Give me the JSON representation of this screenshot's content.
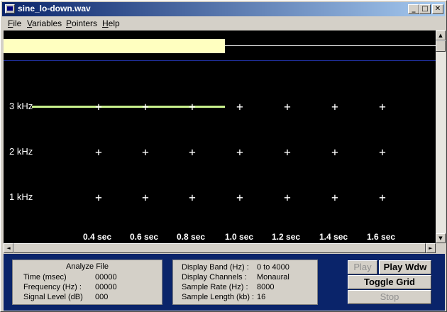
{
  "window": {
    "title": "sine_lo-down.wav",
    "min_glyph": "_",
    "max_glyph": "□",
    "close_glyph": "✕"
  },
  "menu": [
    {
      "label": "File",
      "key": "F",
      "rest": "ile"
    },
    {
      "label": "Variables",
      "key": "V",
      "rest": "ariables"
    },
    {
      "label": "Pointers",
      "key": "P",
      "rest": "ointers"
    },
    {
      "label": "Help",
      "key": "H",
      "rest": "elp"
    }
  ],
  "display": {
    "freq_labels": [
      "3  kHz",
      "2  kHz",
      "1  kHz"
    ],
    "time_labels": [
      "0.4 sec",
      "0.6 sec",
      "0.8 sec",
      "1.0 sec",
      "1.2 sec",
      "1.4 sec",
      "1.6 sec"
    ],
    "grid_marker": "+",
    "colors": {
      "background": "#000000",
      "signal": "#c8f08c",
      "highlight": "#ffffc0",
      "divider": "#2030a0"
    }
  },
  "analyze": {
    "title": "Analyze File",
    "rows": [
      {
        "label": "Time (msec)",
        "value": "00000"
      },
      {
        "label": "Frequency (Hz) :",
        "value": "00000"
      },
      {
        "label": "Signal Level (dB)",
        "value": "000"
      }
    ]
  },
  "file_info": {
    "rows": [
      {
        "label": "Display Band (Hz) :",
        "value": "0 to 4000"
      },
      {
        "label": "Display Channels :",
        "value": "Monaural"
      },
      {
        "label": "Sample Rate (Hz) :",
        "value": "8000"
      },
      {
        "label": "Sample Length (kb) :",
        "value": "16"
      }
    ]
  },
  "buttons": {
    "play": "Play",
    "play_wdw": "Play Wdw",
    "toggle_grid": "Toggle Grid",
    "stop": "Stop"
  },
  "scroll": {
    "up": "▲",
    "down": "▼",
    "left": "◄",
    "right": "►"
  }
}
